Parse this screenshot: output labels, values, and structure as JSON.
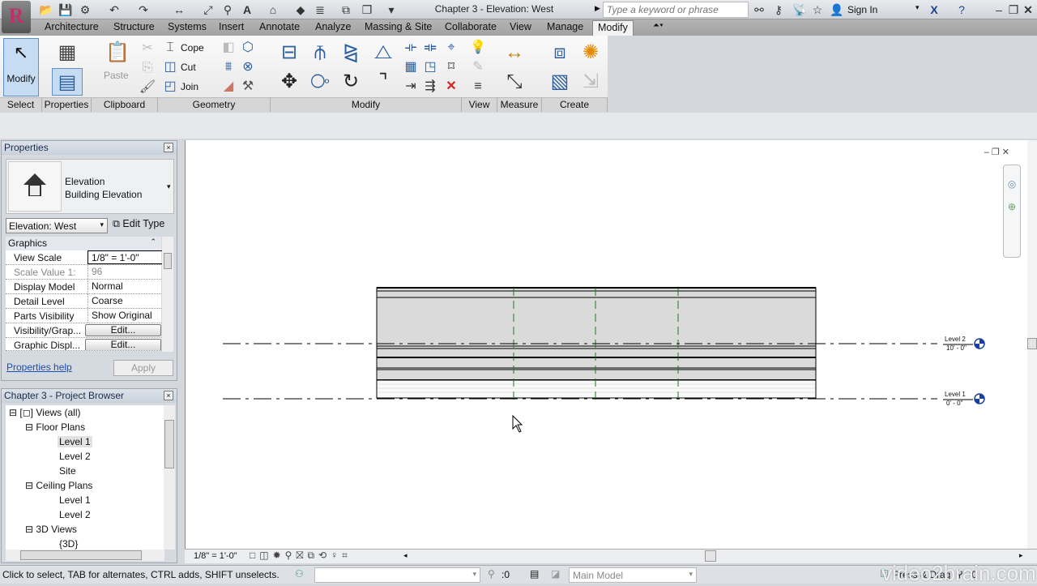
{
  "titlebar": {
    "title": "Chapter 3 - Elevation: West",
    "search_placeholder": "Type a keyword or phrase",
    "sign_in": "Sign In"
  },
  "tabs": [
    "Architecture",
    "Structure",
    "Systems",
    "Insert",
    "Annotate",
    "Analyze",
    "Massing & Site",
    "Collaborate",
    "View",
    "Manage",
    "Modify"
  ],
  "ribbon": {
    "select": {
      "modify": "Modify",
      "label": "Select"
    },
    "properties": {
      "label": "Properties"
    },
    "clipboard": {
      "paste": "Paste",
      "label": "Clipboard"
    },
    "geometry": {
      "cope": "Cope",
      "cut": "Cut",
      "join": "Join",
      "label": "Geometry"
    },
    "modify": {
      "label": "Modify"
    },
    "view": {
      "label": "View"
    },
    "measure": {
      "label": "Measure"
    },
    "create": {
      "label": "Create"
    }
  },
  "properties": {
    "title": "Properties",
    "type_name": "Elevation",
    "type_sub": "Building Elevation",
    "selector": "Elevation: West",
    "edit_type": "Edit Type",
    "group": "Graphics",
    "rows": [
      {
        "k": "View Scale",
        "v": "1/8\" = 1'-0\""
      },
      {
        "k": "Scale Value    1:",
        "v": "96"
      },
      {
        "k": "Display Model",
        "v": "Normal"
      },
      {
        "k": "Detail Level",
        "v": "Coarse"
      },
      {
        "k": "Parts Visibility",
        "v": "Show Original"
      },
      {
        "k": "Visibility/Grap...",
        "v": "Edit..."
      },
      {
        "k": "Graphic Displ...",
        "v": "Edit..."
      }
    ],
    "help": "Properties help",
    "apply": "Apply"
  },
  "browser": {
    "title": "Chapter 3 - Project Browser",
    "items": [
      "Views (all)",
      "Floor Plans",
      "Level 1",
      "Level 2",
      "Site",
      "Ceiling Plans",
      "Level 1",
      "Level 2",
      "3D Views",
      "{3D}"
    ]
  },
  "canvas": {
    "levels": [
      {
        "name": "Level 2",
        "elev": "10' - 0\""
      },
      {
        "name": "Level 1",
        "elev": "0' - 0\""
      }
    ]
  },
  "viewbar": {
    "scale": "1/8\" = 1'-0\""
  },
  "status": {
    "hint": "Click to select, TAB for alternates, CTRL adds, SHIFT unselects.",
    "count": ":0",
    "model": "Main Model",
    "press_drag": "Press & Drag",
    "filter": ":0",
    "watermark": "video2brain.com"
  }
}
